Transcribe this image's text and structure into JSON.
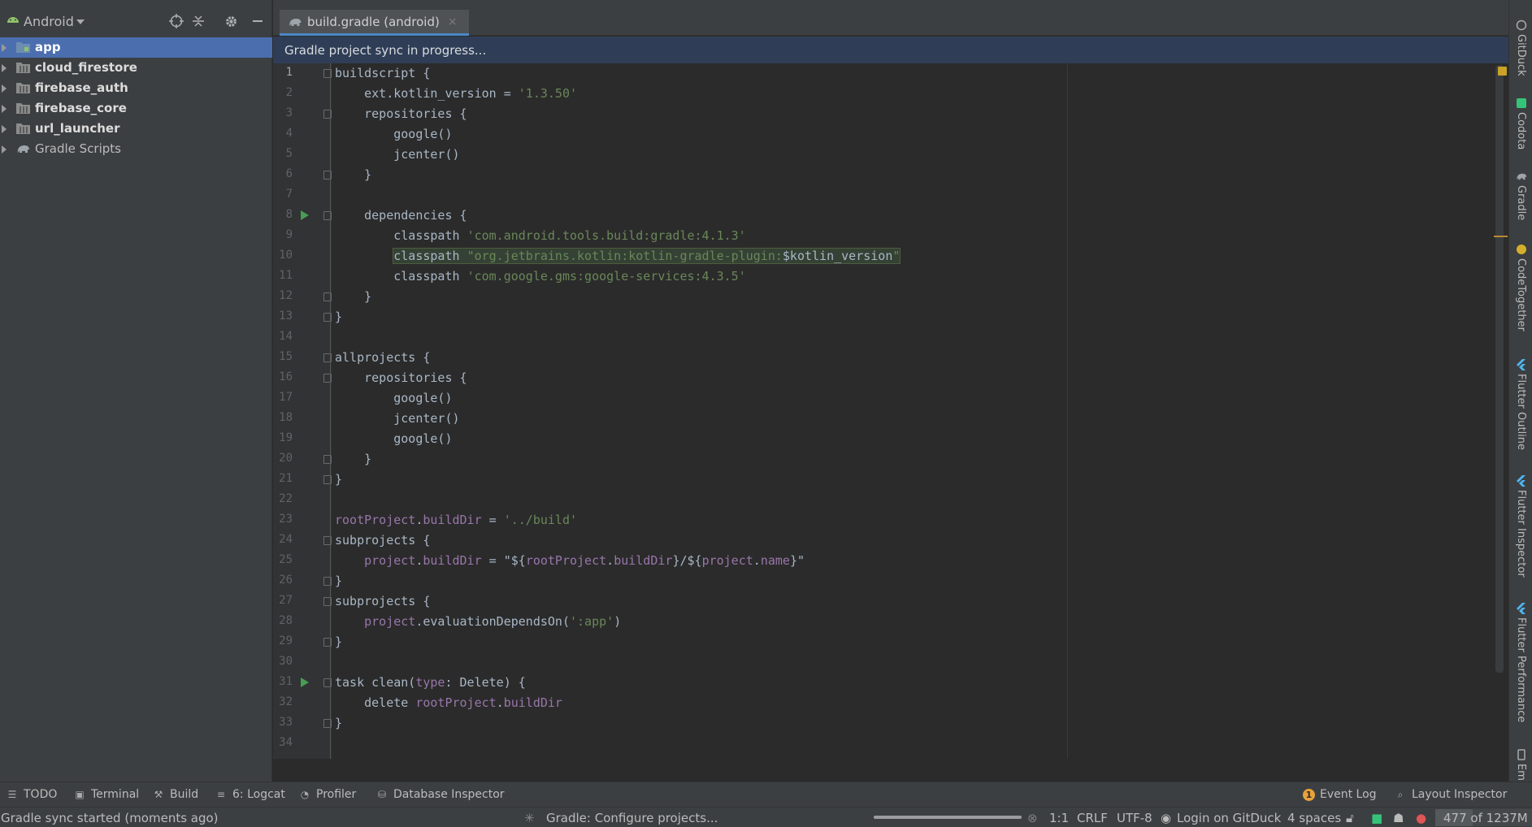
{
  "project_panel": {
    "view_selector": "Android",
    "header_icons": [
      "locate-icon",
      "collapse-all-icon",
      "gear-icon",
      "minimize-icon"
    ],
    "tree": [
      {
        "label": "app",
        "icon": "module-folder-icon",
        "selected": true
      },
      {
        "label": "cloud_firestore",
        "icon": "library-module-icon",
        "selected": false
      },
      {
        "label": "firebase_auth",
        "icon": "library-module-icon",
        "selected": false
      },
      {
        "label": "firebase_core",
        "icon": "library-module-icon",
        "selected": false
      },
      {
        "label": "url_launcher",
        "icon": "library-module-icon",
        "selected": false
      },
      {
        "label": "Gradle Scripts",
        "icon": "gradle-elephant-icon",
        "selected": false
      }
    ]
  },
  "editor": {
    "tab_label": "build.gradle (android)",
    "tab_close": "×",
    "sync_banner": "Gradle project sync in progress...",
    "lines": [
      {
        "n": "1",
        "text": "buildscript {"
      },
      {
        "n": "2",
        "text": "    ext.kotlin_version = '1.3.50'"
      },
      {
        "n": "3",
        "text": "    repositories {"
      },
      {
        "n": "4",
        "text": "        google()"
      },
      {
        "n": "5",
        "text": "        jcenter()"
      },
      {
        "n": "6",
        "text": "    }"
      },
      {
        "n": "7",
        "text": ""
      },
      {
        "n": "8",
        "text": "    dependencies {"
      },
      {
        "n": "9",
        "text": "        classpath 'com.android.tools.build:gradle:4.1.3'"
      },
      {
        "n": "10",
        "text": "        classpath \"org.jetbrains.kotlin:kotlin-gradle-plugin:$kotlin_version\""
      },
      {
        "n": "11",
        "text": "        classpath 'com.google.gms:google-services:4.3.5'"
      },
      {
        "n": "12",
        "text": "    }"
      },
      {
        "n": "13",
        "text": "}"
      },
      {
        "n": "14",
        "text": ""
      },
      {
        "n": "15",
        "text": "allprojects {"
      },
      {
        "n": "16",
        "text": "    repositories {"
      },
      {
        "n": "17",
        "text": "        google()"
      },
      {
        "n": "18",
        "text": "        jcenter()"
      },
      {
        "n": "19",
        "text": "        google()"
      },
      {
        "n": "20",
        "text": "    }"
      },
      {
        "n": "21",
        "text": "}"
      },
      {
        "n": "22",
        "text": ""
      },
      {
        "n": "23",
        "text": "rootProject.buildDir = '../build'"
      },
      {
        "n": "24",
        "text": "subprojects {"
      },
      {
        "n": "25",
        "text": "    project.buildDir = \"${rootProject.buildDir}/${project.name}\""
      },
      {
        "n": "26",
        "text": "}"
      },
      {
        "n": "27",
        "text": "subprojects {"
      },
      {
        "n": "28",
        "text": "    project.evaluationDependsOn(':app')"
      },
      {
        "n": "29",
        "text": "}"
      },
      {
        "n": "30",
        "text": ""
      },
      {
        "n": "31",
        "text": "task clean(type: Delete) {"
      },
      {
        "n": "32",
        "text": "    delete rootProject.buildDir"
      },
      {
        "n": "33",
        "text": "}"
      },
      {
        "n": "34",
        "text": ""
      }
    ]
  },
  "right_tools": [
    "GitDuck",
    "Codota",
    "Gradle",
    "CodeTogether",
    "Flutter Outline",
    "Flutter Inspector",
    "Flutter Performance",
    "Em"
  ],
  "bottom_tools": {
    "todo": "TODO",
    "terminal": "Terminal",
    "build": "Build",
    "logcat": "6: Logcat",
    "profiler": "Profiler",
    "database_inspector": "Database Inspector",
    "event_log": "Event Log",
    "event_log_badge": "1",
    "layout_inspector": "Layout Inspector"
  },
  "status_bar": {
    "message": "Gradle sync started (moments ago)",
    "task": "Gradle: Configure projects...",
    "position": "1:1",
    "line_sep": "CRLF",
    "encoding": "UTF-8",
    "gitduck": "Login on GitDuck",
    "indent": "4 spaces",
    "memory": "477 of 1237M",
    "memory_fraction": 0.386
  },
  "colors": {
    "accent": "#4b6eaf",
    "banner": "#2f3e56",
    "string": "#6a8759",
    "property": "#9876aa"
  }
}
